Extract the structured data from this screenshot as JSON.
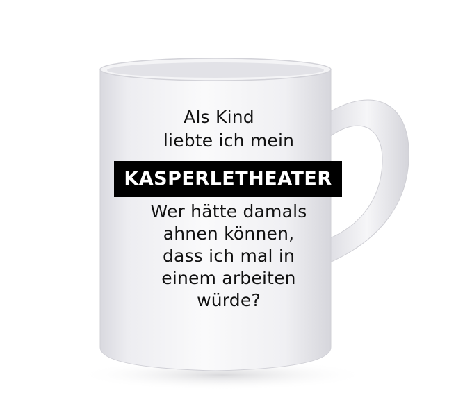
{
  "mug_print": {
    "line_1": "Als Kind",
    "line_2": "liebte ich mein",
    "banner": "KASPERLETHEATER",
    "line_3": "Wer hätte damals",
    "line_4": "ahnen können,",
    "line_5": "dass ich mal in",
    "line_6": "einem arbeiten",
    "line_7": "würde?"
  },
  "colors": {
    "background": "#ffffff",
    "mug_body": "#f2f2f4",
    "text": "#111111",
    "banner_background": "#000000",
    "banner_text": "#ffffff"
  }
}
